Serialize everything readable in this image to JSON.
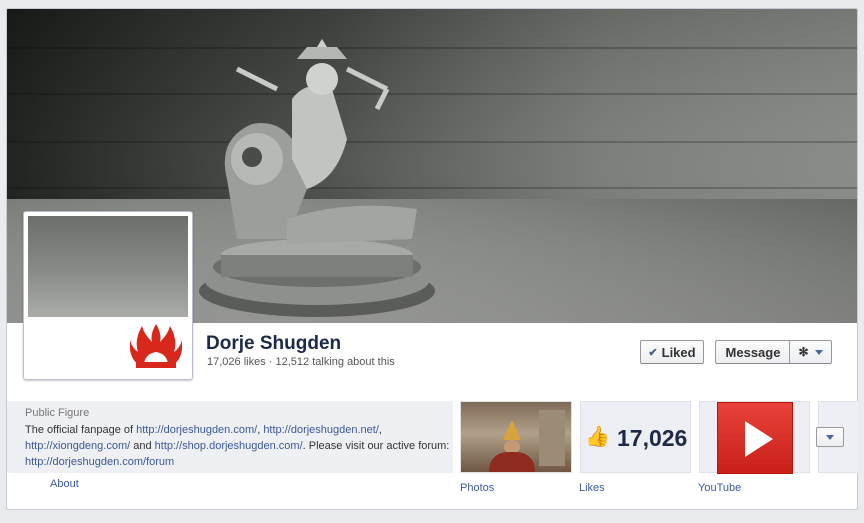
{
  "page": {
    "name": "Dorje Shugden",
    "likes_text": "17,026 likes",
    "separator": "·",
    "talking_text": "12,512 talking about this"
  },
  "actions": {
    "liked_label": "Liked",
    "message_label": "Message"
  },
  "about": {
    "category": "Public Figure",
    "desc_1": "The official fanpage of ",
    "link_1": "http://dorjeshugden.com/",
    "sep_1": ", ",
    "link_2": "http://dorjeshugden.net/",
    "sep_2": ",",
    "link_3": "http://xiongdeng.com/",
    "desc_2": " and ",
    "link_4": "http://shop.dorjeshugden.com/",
    "desc_3": ". Please visit our active forum: ",
    "link_5": "http://dorjeshugden.com/forum",
    "about_link": "About"
  },
  "tiles": {
    "photos_label": "Photos",
    "likes_count": "17,026",
    "likes_label": "Likes",
    "youtube_label": "YouTube"
  },
  "icons": [
    "check-icon",
    "gear-icon",
    "chevron-down-icon",
    "thumbs-up-icon",
    "youtube-play-icon",
    "flame-logo-icon"
  ],
  "colors": {
    "brand": "#3b5998",
    "name": "#1c2a47",
    "youtube": "#e8423a",
    "logo": "#d8281c"
  }
}
